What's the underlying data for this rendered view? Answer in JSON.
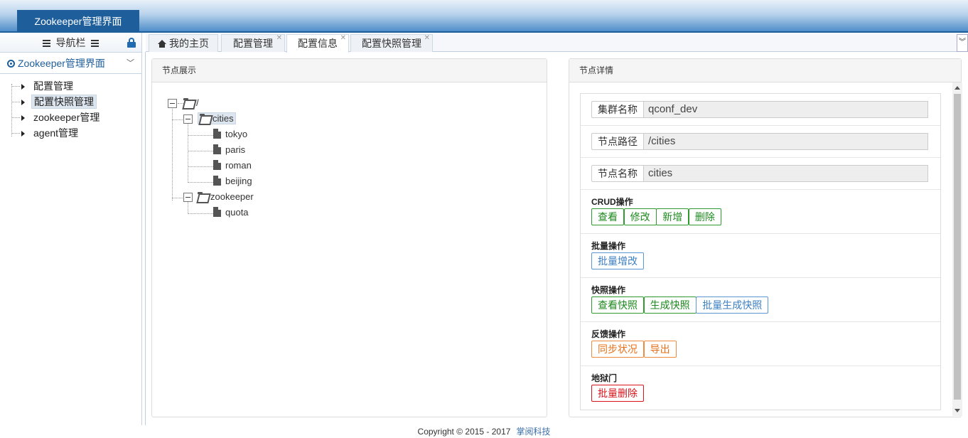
{
  "app": {
    "title": "Zookeeper管理界面"
  },
  "sidebar": {
    "nav_title": "导航栏",
    "group_label": "Zookeeper管理界面",
    "items": [
      {
        "label": "配置管理"
      },
      {
        "label": "配置快照管理"
      },
      {
        "label": "zookeeper管理"
      },
      {
        "label": "agent管理"
      }
    ]
  },
  "tabs": [
    {
      "label": "我的主页"
    },
    {
      "label": "配置管理"
    },
    {
      "label": "配置信息"
    },
    {
      "label": "配置快照管理"
    }
  ],
  "tree_panel": {
    "title": "节点展示",
    "root": "/",
    "nodes": {
      "cities": "cities",
      "tokyo": "tokyo",
      "paris": "paris",
      "roman": "roman",
      "beijing": "beijing",
      "zookeeper": "zookeeper",
      "quota": "quota"
    }
  },
  "detail_panel": {
    "title": "节点详情",
    "fields": [
      {
        "label": "集群名称",
        "value": "qconf_dev"
      },
      {
        "label": "节点路径",
        "value": "/cities"
      },
      {
        "label": "节点名称",
        "value": "cities"
      }
    ],
    "groups": {
      "crud": {
        "title": "CRUD操作",
        "buttons": [
          "查看",
          "修改",
          "新增",
          "删除"
        ]
      },
      "batch": {
        "title": "批量操作",
        "buttons": [
          "批量增改"
        ]
      },
      "snapshot": {
        "title": "快照操作",
        "buttons": [
          "查看快照",
          "生成快照",
          "批量生成快照"
        ]
      },
      "feedback": {
        "title": "反馈操作",
        "buttons": [
          "同步状况",
          "导出"
        ]
      },
      "danger": {
        "title": "地狱门",
        "buttons": [
          "批量删除"
        ]
      }
    }
  },
  "footer": {
    "copyright": "Copyright © 2015 - 2017",
    "company": "掌阅科技"
  },
  "colors": {
    "header_blue": "#1e5f9b",
    "btn_green": "#1e8a1e",
    "btn_blue": "#3d7fc1",
    "btn_orange": "#e4711a",
    "btn_red": "#d9141c"
  }
}
